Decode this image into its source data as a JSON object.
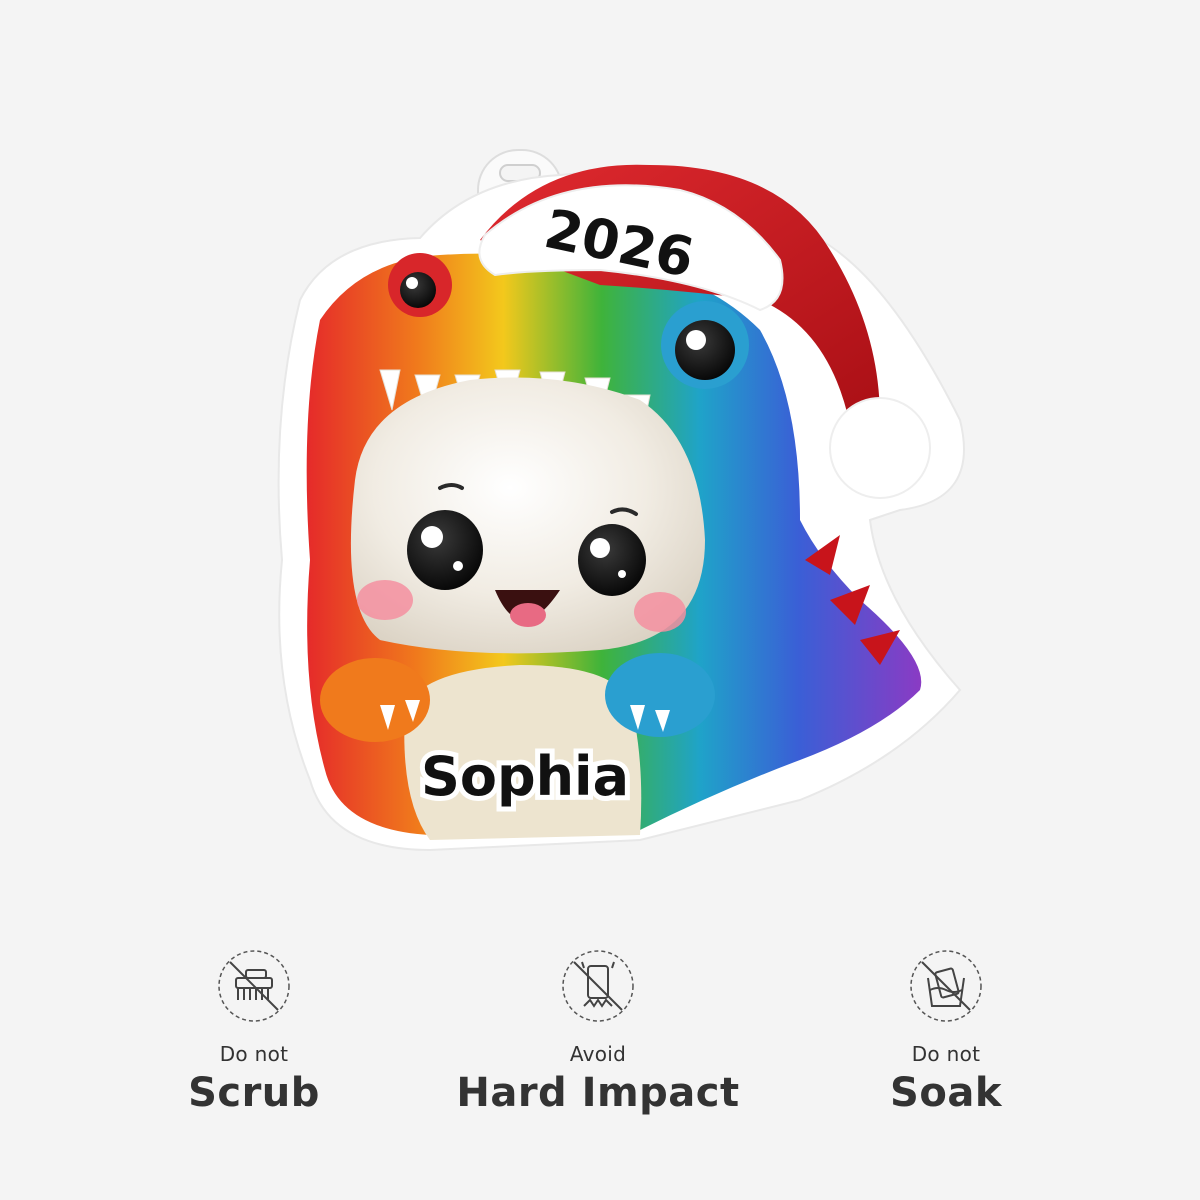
{
  "ornament": {
    "year": "2026",
    "name": "Sophia"
  },
  "care": [
    {
      "icon": "no-scrub-icon",
      "line1": "Do not",
      "line2": "Scrub"
    },
    {
      "icon": "no-hard-impact-icon",
      "line1": "Avoid",
      "line2": "Hard Impact"
    },
    {
      "icon": "no-soak-icon",
      "line1": "Do not",
      "line2": "Soak"
    }
  ],
  "colors": {
    "background": "#f4f4f4",
    "hat_red": "#c8141b",
    "text_dark": "#333333"
  }
}
